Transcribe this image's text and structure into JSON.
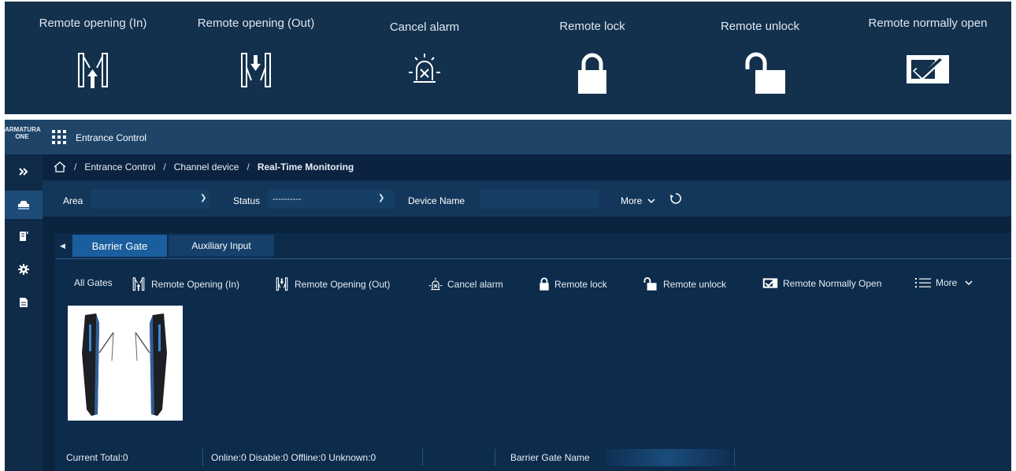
{
  "legend": {
    "items": [
      {
        "label": "Remote opening (In)",
        "icon": "gate-open-in-icon"
      },
      {
        "label": "Remote opening (Out)",
        "icon": "gate-open-out-icon"
      },
      {
        "label": "Cancel alarm",
        "icon": "cancel-alarm-icon"
      },
      {
        "label": "Remote lock",
        "icon": "lock-icon"
      },
      {
        "label": "Remote unlock",
        "icon": "unlock-icon"
      },
      {
        "label": "Remote normally open",
        "icon": "normally-open-icon"
      }
    ]
  },
  "app": {
    "logo_line1": "ARMATURA",
    "logo_line2": "ONE",
    "title": "Entrance Control"
  },
  "sidebar": {
    "items": [
      {
        "icon": "expand-icon"
      },
      {
        "icon": "barrier-gate-icon",
        "active": true
      },
      {
        "icon": "document-icon"
      },
      {
        "icon": "gear-icon"
      },
      {
        "icon": "report-icon"
      }
    ]
  },
  "breadcrumb": {
    "items": [
      "Entrance Control",
      "Channel device",
      "Real-Time Monitoring"
    ]
  },
  "filters": {
    "area_label": "Area",
    "status_label": "Status",
    "status_value": "----------",
    "device_name_label": "Device Name",
    "device_name_value": "",
    "more_label": "More"
  },
  "tabs": [
    {
      "label": "Barrier Gate",
      "active": true
    },
    {
      "label": "Auxiliary Input",
      "active": false
    }
  ],
  "toolbar": {
    "all_gates": "All Gates",
    "remote_opening_in": "Remote Opening (In)",
    "remote_opening_out": "Remote Opening (Out)",
    "cancel_alarm": "Cancel alarm",
    "remote_lock": "Remote lock",
    "remote_unlock": "Remote unlock",
    "remote_normally_open": "Remote Normally Open",
    "more": "More"
  },
  "footer": {
    "current_total": "Current Total:0",
    "status_counts": "Online:0 Disable:0 Offline:0 Unknown:0",
    "barrier_gate_name_label": "Barrier Gate Name",
    "barrier_gate_name_value": ""
  },
  "colors": {
    "legend_bg": "#13304d",
    "topbar_bg": "#1e4568",
    "main_bg": "#0a2440",
    "active_tab": "#1b5e9d"
  }
}
